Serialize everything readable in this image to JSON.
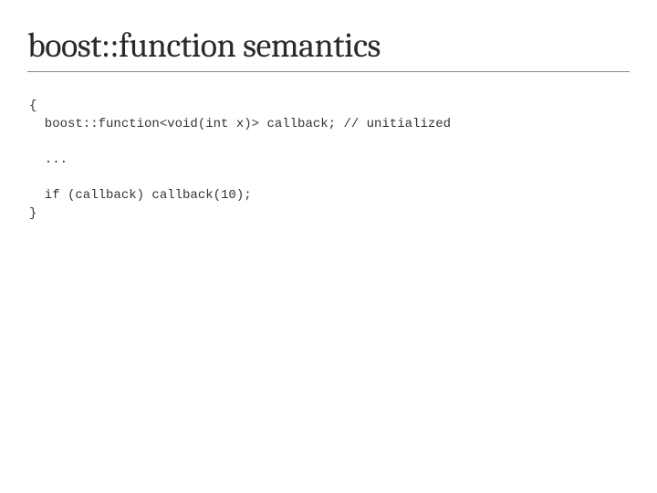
{
  "title": "boost::function semantics",
  "code": {
    "l1": "{",
    "l2": "  boost::function<void(int x)> callback; // unitialized",
    "l3": "",
    "l4": "  ...",
    "l5": "",
    "l6": "  if (callback) callback(10);",
    "l7": "}"
  }
}
